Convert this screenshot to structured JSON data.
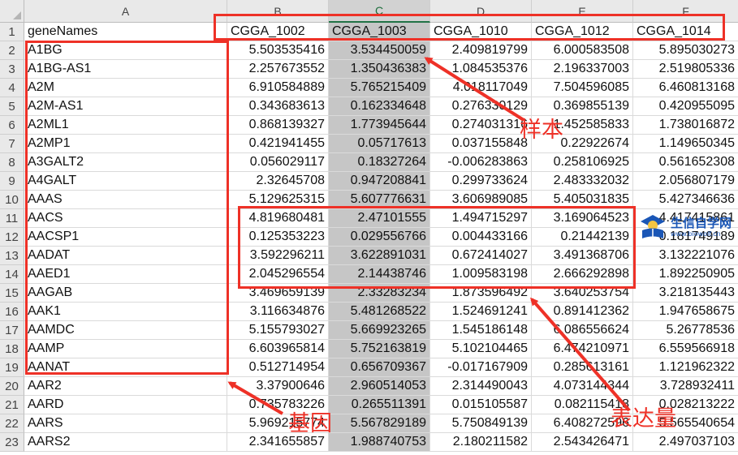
{
  "sheet": {
    "column_letters": [
      "A",
      "B",
      "C",
      "D",
      "E",
      "F"
    ],
    "selected_column": "C",
    "row_numbers": [
      1,
      2,
      3,
      4,
      5,
      6,
      7,
      8,
      9,
      10,
      11,
      12,
      13,
      14,
      15,
      16,
      17,
      18,
      19,
      20,
      21,
      22,
      23
    ],
    "header_row": [
      "geneNames",
      "CGGA_1002",
      "CGGA_1003",
      "CGGA_1010",
      "CGGA_1012",
      "CGGA_1014"
    ],
    "rows": [
      [
        "A1BG",
        "5.503535416",
        "3.534450059",
        "2.409819799",
        "6.000583508",
        "5.895030273"
      ],
      [
        "A1BG-AS1",
        "2.257673552",
        "1.350436383",
        "1.084535376",
        "2.196337003",
        "2.519805336"
      ],
      [
        "A2M",
        "6.910584889",
        "5.765215409",
        "4.018117049",
        "7.504596085",
        "6.460813168"
      ],
      [
        "A2M-AS1",
        "0.343683613",
        "0.162334648",
        "0.276330129",
        "0.369855139",
        "0.420955095"
      ],
      [
        "A2ML1",
        "0.868139327",
        "1.773945644",
        "0.274031316",
        "1.452585833",
        "1.738016872"
      ],
      [
        "A2MP1",
        "0.421941455",
        "0.05717613",
        "0.037155848",
        "0.22922674",
        "1.149650345"
      ],
      [
        "A3GALT2",
        "0.056029117",
        "0.18327264",
        "-0.006283863",
        "0.258106925",
        "0.561652308"
      ],
      [
        "A4GALT",
        "2.32645708",
        "0.947208841",
        "0.299733624",
        "2.483332032",
        "2.056807179"
      ],
      [
        "AAAS",
        "5.129625315",
        "5.607776631",
        "3.606989085",
        "5.405031835",
        "5.427346636"
      ],
      [
        "AACS",
        "4.819680481",
        "2.47101555",
        "1.494715297",
        "3.169064523",
        "4.417415861"
      ],
      [
        "AACSP1",
        "0.125353223",
        "0.029556766",
        "0.004433166",
        "0.21442139",
        "0.181749189"
      ],
      [
        "AADAT",
        "3.592296211",
        "3.622891031",
        "0.672414027",
        "3.491368706",
        "3.132221076"
      ],
      [
        "AAED1",
        "2.045296554",
        "2.14438746",
        "1.009583198",
        "2.666292898",
        "1.892250905"
      ],
      [
        "AAGAB",
        "3.469659139",
        "2.33283234",
        "1.873596492",
        "3.640253754",
        "3.218135443"
      ],
      [
        "AAK1",
        "3.116634876",
        "5.481268522",
        "1.524691241",
        "0.891412362",
        "1.947658675"
      ],
      [
        "AAMDC",
        "5.155793027",
        "5.669923265",
        "1.545186148",
        "6.086556624",
        "5.26778536"
      ],
      [
        "AAMP",
        "6.603965814",
        "5.752163819",
        "5.102104465",
        "6.474210971",
        "6.559566918"
      ],
      [
        "AANAT",
        "0.512714954",
        "0.656709367",
        "-0.017167909",
        "0.285613161",
        "1.121962322"
      ],
      [
        "AAR2",
        "3.37900646",
        "2.960514053",
        "2.314490043",
        "4.073144344",
        "3.728932411"
      ],
      [
        "AARD",
        "0.735783226",
        "0.265511391",
        "0.015105587",
        "0.082115418",
        "0.028213222"
      ],
      [
        "AARS",
        "5.969215774",
        "5.567829189",
        "5.750849139",
        "6.408272596",
        "5.565540654"
      ],
      [
        "AARS2",
        "2.341655857",
        "1.988740753",
        "2.180211582",
        "2.543426471",
        "2.497037103"
      ]
    ]
  },
  "annotations": {
    "samples_label": "样本",
    "genes_label": "基因",
    "expression_label": "表达量",
    "color": "#ee3127"
  },
  "watermark": {
    "title": "生信自学网",
    "subtitle": "www.biowolf.cn",
    "icon": "reading-person-icon"
  },
  "colors": {
    "selected_column_fill": "#c6c6c6",
    "header_fill": "#e9e9e9",
    "accent_green": "#217346"
  }
}
